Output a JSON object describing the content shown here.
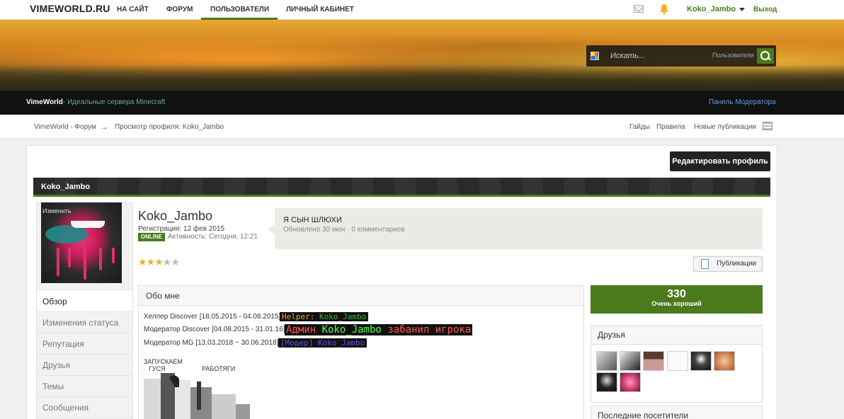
{
  "topnav": {
    "logo": "VIMEWORLD.RU",
    "items": [
      "НА САЙТ",
      "ФОРУМ",
      "ПОЛЬЗОВАТЕЛИ",
      "ЛИЧНЫЙ КАБИНЕТ"
    ],
    "active_item": "ПОЛЬЗОВАТЕЛИ",
    "username": "Koko_Jambo",
    "logout": "Выход",
    "accent_color": "#4b7a1c"
  },
  "search": {
    "placeholder": "Искать...",
    "scope": "Пользователи"
  },
  "strip": {
    "brand": "VimeWorld",
    "tagline": "- Идеальные сервера Minecraft",
    "moderator_link": "Панель Модератора"
  },
  "breadcrumb": {
    "items": [
      "VimeWorld - Форум",
      "Просмотр профиля: Koko_Jambo"
    ],
    "separator": "→",
    "right_links": [
      "Гайды",
      "Правила",
      "Новые публикации"
    ]
  },
  "profile": {
    "edit_button": "Редактировать профиль",
    "name_bar": "Koko_Jambo",
    "avatar_edit": "Изменить",
    "name": "Koko_Jambo",
    "registered": "Регистрация: 12 фев 2015",
    "online_badge": "ONLINE",
    "activity": "Активность: Сегодня, 12:21",
    "rating_stars": 3,
    "rating_max": 5
  },
  "status": {
    "text": "Я СЫН ШЛЮХИ",
    "meta": "Обновлено 30 июн · 0 комментариев"
  },
  "publications_button": "Публикации",
  "left_nav": [
    "Обзор",
    "Изменения статуса",
    "Репутация",
    "Друзья",
    "Темы",
    "Сообщения"
  ],
  "left_nav_active": "Обзор",
  "about": {
    "title": "Обо мне",
    "lines": [
      "Хелпер Discover [18.05.2015 - 04.08.2015]",
      "Модератор Discover [04.08.2015 - 31.01.16]",
      "Модератор MG [13.03.2018 ~ 30.06.2018]"
    ],
    "tag_helper_prefix": "Helper: ",
    "tag_helper_name": "Koko_Jambo",
    "tag_admin_prefix": "Админ ",
    "tag_admin_name": "Koko_Jambo",
    "tag_admin_suffix": " забанил игрока",
    "tag_moder": "[Модер] Koko_Jambo",
    "ascii_caption_1": "ЗАПУСКАЕМ",
    "ascii_caption_2": "ГУСЯ",
    "ascii_caption_3": "РАБОТЯГИ"
  },
  "reputation": {
    "value": "330",
    "label": "Очень хороший"
  },
  "friends": {
    "title": "Друзья",
    "count_shown": 8
  },
  "visitors": {
    "title": "Последние посетители"
  }
}
